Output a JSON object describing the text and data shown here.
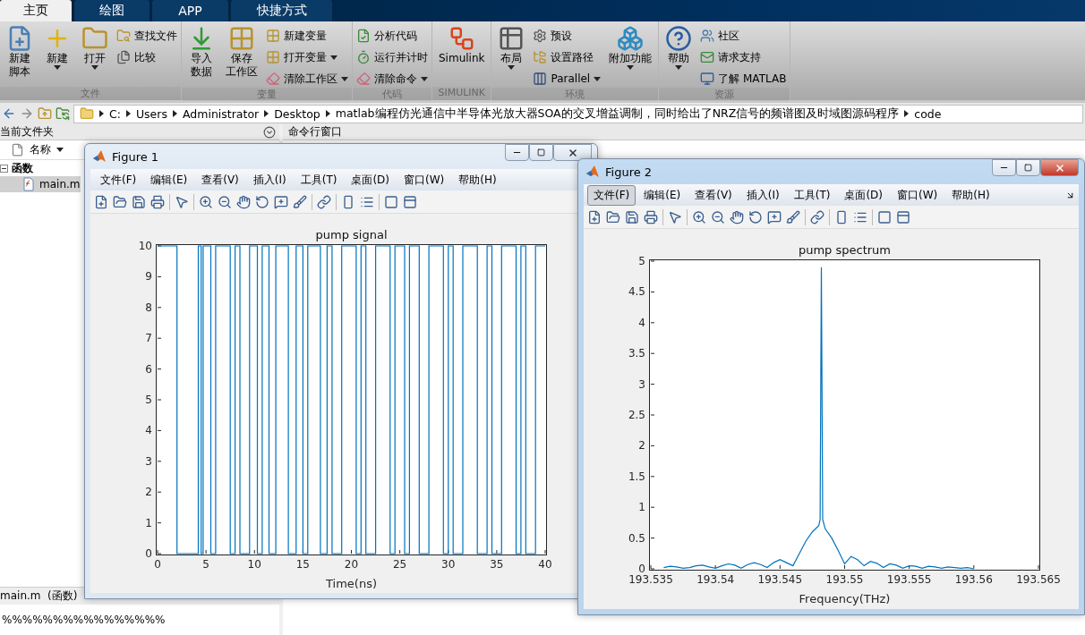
{
  "tabs": [
    {
      "label": "主页",
      "selected": true
    },
    {
      "label": "绘图",
      "selected": false
    },
    {
      "label": "APP",
      "selected": false
    },
    {
      "label": "快捷方式",
      "selected": false
    }
  ],
  "ribbon": [
    {
      "label": "文件",
      "columns": [
        {
          "kind": "large",
          "lines": [
            "新建",
            "脚本"
          ],
          "dropdown": false
        },
        {
          "kind": "large",
          "lines": [
            "新建"
          ],
          "dropdown": true
        },
        {
          "kind": "large",
          "lines": [
            "打开"
          ],
          "dropdown": true
        },
        {
          "kind": "stack",
          "items": [
            {
              "label": "查找文件",
              "dropdown": false
            },
            {
              "label": "比较",
              "dropdown": false
            }
          ]
        }
      ]
    },
    {
      "label": "变量",
      "columns": [
        {
          "kind": "large",
          "lines": [
            "导入",
            "数据"
          ],
          "dropdown": false
        },
        {
          "kind": "large",
          "lines": [
            "保存",
            "工作区"
          ],
          "dropdown": false
        },
        {
          "kind": "stack",
          "items": [
            {
              "label": "新建变量",
              "dropdown": false
            },
            {
              "label": "打开变量",
              "dropdown": true
            },
            {
              "label": "清除工作区",
              "dropdown": true
            }
          ]
        }
      ]
    },
    {
      "label": "代码",
      "columns": [
        {
          "kind": "stack",
          "items": [
            {
              "label": "分析代码",
              "dropdown": false
            },
            {
              "label": "运行并计时",
              "dropdown": false
            },
            {
              "label": "清除命令",
              "dropdown": true
            }
          ]
        }
      ]
    },
    {
      "label": "SIMULINK",
      "columns": [
        {
          "kind": "large",
          "lines": [
            "Simulink"
          ],
          "dropdown": false
        }
      ]
    },
    {
      "label": "环境",
      "columns": [
        {
          "kind": "large",
          "lines": [
            "布局"
          ],
          "dropdown": true
        },
        {
          "kind": "stack",
          "items": [
            {
              "label": "预设",
              "dropdown": false
            },
            {
              "label": "设置路径",
              "dropdown": false
            },
            {
              "label": "Parallel",
              "dropdown": true
            }
          ]
        },
        {
          "kind": "large",
          "lines": [
            "附加功能"
          ],
          "dropdown": true
        }
      ]
    },
    {
      "label": "资源",
      "columns": [
        {
          "kind": "large",
          "lines": [
            "帮助"
          ],
          "dropdown": true
        },
        {
          "kind": "stack",
          "items": [
            {
              "label": "社区",
              "dropdown": false
            },
            {
              "label": "请求支持",
              "dropdown": false
            },
            {
              "label": "了解 MATLAB",
              "dropdown": false
            }
          ]
        }
      ]
    }
  ],
  "address": {
    "crumbs": [
      "C:",
      "Users",
      "Administrator",
      "Desktop",
      "matlab编程仿光通信中半导体光放大器SOA的交叉增益调制，同时给出了NRZ信号的频谱图及时域图源码程序",
      "code"
    ]
  },
  "current_folder": {
    "title": "当前文件夹",
    "column": "名称",
    "tree": [
      {
        "label": "函数",
        "expanded": true,
        "children": [
          {
            "label": "main.m",
            "selected": true
          }
        ]
      }
    ],
    "details": "main.m  (函数)",
    "preview": "%%%%%%%%%%%%%%%%"
  },
  "command_window": {
    "title": "命令行窗口"
  },
  "figures": [
    {
      "title": "Figure 1",
      "active": false,
      "menus": [
        {
          "label": "文件(F)",
          "selected": false
        },
        {
          "label": "编辑(E)",
          "selected": false
        },
        {
          "label": "查看(V)",
          "selected": false
        },
        {
          "label": "插入(I)",
          "selected": false
        },
        {
          "label": "工具(T)",
          "selected": false
        },
        {
          "label": "桌面(D)",
          "selected": false
        },
        {
          "label": "窗口(W)",
          "selected": false
        },
        {
          "label": "帮助(H)",
          "selected": false
        }
      ],
      "chart_data": {
        "type": "line",
        "title": "pump signal",
        "xlabel": "Time(ns)",
        "xlim": [
          0,
          40
        ],
        "ylim": [
          0,
          10
        ],
        "xticks": [
          0,
          5,
          10,
          15,
          20,
          25,
          30,
          35,
          40
        ],
        "yticks": [
          0,
          1,
          2,
          3,
          4,
          5,
          6,
          7,
          8,
          9,
          10
        ],
        "x": [
          0,
          2,
          2,
          4.2,
          4.2,
          4.5,
          4.5,
          4.7,
          4.7,
          5.5,
          5.5,
          6,
          6,
          7.5,
          7.5,
          8,
          8,
          8.5,
          8.5,
          9.5,
          9.5,
          10.3,
          10.3,
          10.8,
          10.8,
          11.5,
          11.5,
          12.2,
          12.2,
          13.5,
          13.5,
          14.3,
          14.3,
          15,
          15,
          15.5,
          15.5,
          16.8,
          16.8,
          17.5,
          17.5,
          18,
          18,
          19,
          19,
          20.5,
          20.5,
          21,
          21,
          21.5,
          21.5,
          22.5,
          22.5,
          24,
          24,
          24.5,
          24.5,
          25.5,
          25.5,
          26,
          26,
          27,
          27,
          28,
          28,
          29.5,
          29.5,
          30,
          30,
          30.5,
          30.5,
          31.5,
          31.5,
          33,
          33,
          34,
          34,
          34.5,
          34.5,
          35.5,
          35.5,
          37,
          37,
          37.5,
          37.5,
          38,
          38,
          39,
          39,
          40
        ],
        "series": [
          {
            "color": "#0072bd",
            "values": [
              10,
              10,
              0,
              0,
              10,
              10,
              0,
              0,
              10,
              10,
              0,
              0,
              10,
              10,
              0,
              0,
              10,
              10,
              0,
              0,
              10,
              10,
              0,
              0,
              10,
              10,
              0,
              0,
              10,
              10,
              0,
              0,
              10,
              10,
              0,
              0,
              10,
              10,
              0,
              0,
              10,
              10,
              0,
              0,
              10,
              10,
              0,
              0,
              10,
              10,
              0,
              0,
              10,
              10,
              0,
              0,
              10,
              10,
              0,
              0,
              10,
              10,
              0,
              0,
              10,
              10,
              0,
              0,
              10,
              10,
              0,
              0,
              10,
              10,
              0,
              0,
              10,
              10,
              0,
              0,
              10,
              10,
              0,
              0,
              10,
              10,
              0,
              0,
              10,
              10
            ]
          }
        ]
      }
    },
    {
      "title": "Figure 2",
      "active": true,
      "menus": [
        {
          "label": "文件(F)",
          "selected": true
        },
        {
          "label": "编辑(E)",
          "selected": false
        },
        {
          "label": "查看(V)",
          "selected": false
        },
        {
          "label": "插入(I)",
          "selected": false
        },
        {
          "label": "工具(T)",
          "selected": false
        },
        {
          "label": "桌面(D)",
          "selected": false
        },
        {
          "label": "窗口(W)",
          "selected": false
        },
        {
          "label": "帮助(H)",
          "selected": false
        }
      ],
      "chart_data": {
        "type": "line",
        "title": "pump spectrum",
        "xlabel": "Frequency(THz)",
        "xlim": [
          193.535,
          193.565
        ],
        "ylim": [
          0,
          5
        ],
        "xticks": [
          193.535,
          193.54,
          193.545,
          193.55,
          193.555,
          193.56,
          193.565
        ],
        "yticks": [
          0,
          0.5,
          1,
          1.5,
          2,
          2.5,
          3,
          3.5,
          4,
          4.5,
          5
        ],
        "x": [
          193.536,
          193.5365,
          193.537,
          193.5375,
          193.538,
          193.5385,
          193.539,
          193.5395,
          193.54,
          193.5405,
          193.541,
          193.5415,
          193.542,
          193.5425,
          193.543,
          193.5435,
          193.544,
          193.5445,
          193.545,
          193.5455,
          193.546,
          193.5465,
          193.547,
          193.5475,
          193.548,
          193.5481,
          193.5482,
          193.5483,
          193.5485,
          193.549,
          193.5495,
          193.55,
          193.5505,
          193.551,
          193.5515,
          193.552,
          193.5525,
          193.553,
          193.5535,
          193.554,
          193.5545,
          193.555,
          193.5555,
          193.556,
          193.5565,
          193.557,
          193.5575,
          193.558,
          193.5585,
          193.559,
          193.5595,
          193.56
        ],
        "series": [
          {
            "color": "#0072bd",
            "values": [
              0.02,
              0.04,
              0.03,
              0.01,
              0.02,
              0.05,
              0.06,
              0.03,
              0.01,
              0.05,
              0.08,
              0.06,
              0.01,
              0.07,
              0.1,
              0.07,
              0.02,
              0.1,
              0.15,
              0.1,
              0.05,
              0.25,
              0.45,
              0.6,
              0.7,
              0.8,
              4.9,
              0.8,
              0.65,
              0.5,
              0.3,
              0.08,
              0.2,
              0.15,
              0.05,
              0.12,
              0.09,
              0.02,
              0.08,
              0.06,
              0.01,
              0.05,
              0.04,
              0.01,
              0.04,
              0.03,
              0.01,
              0.03,
              0.02,
              0.01,
              0.02,
              0
            ]
          }
        ]
      }
    }
  ]
}
